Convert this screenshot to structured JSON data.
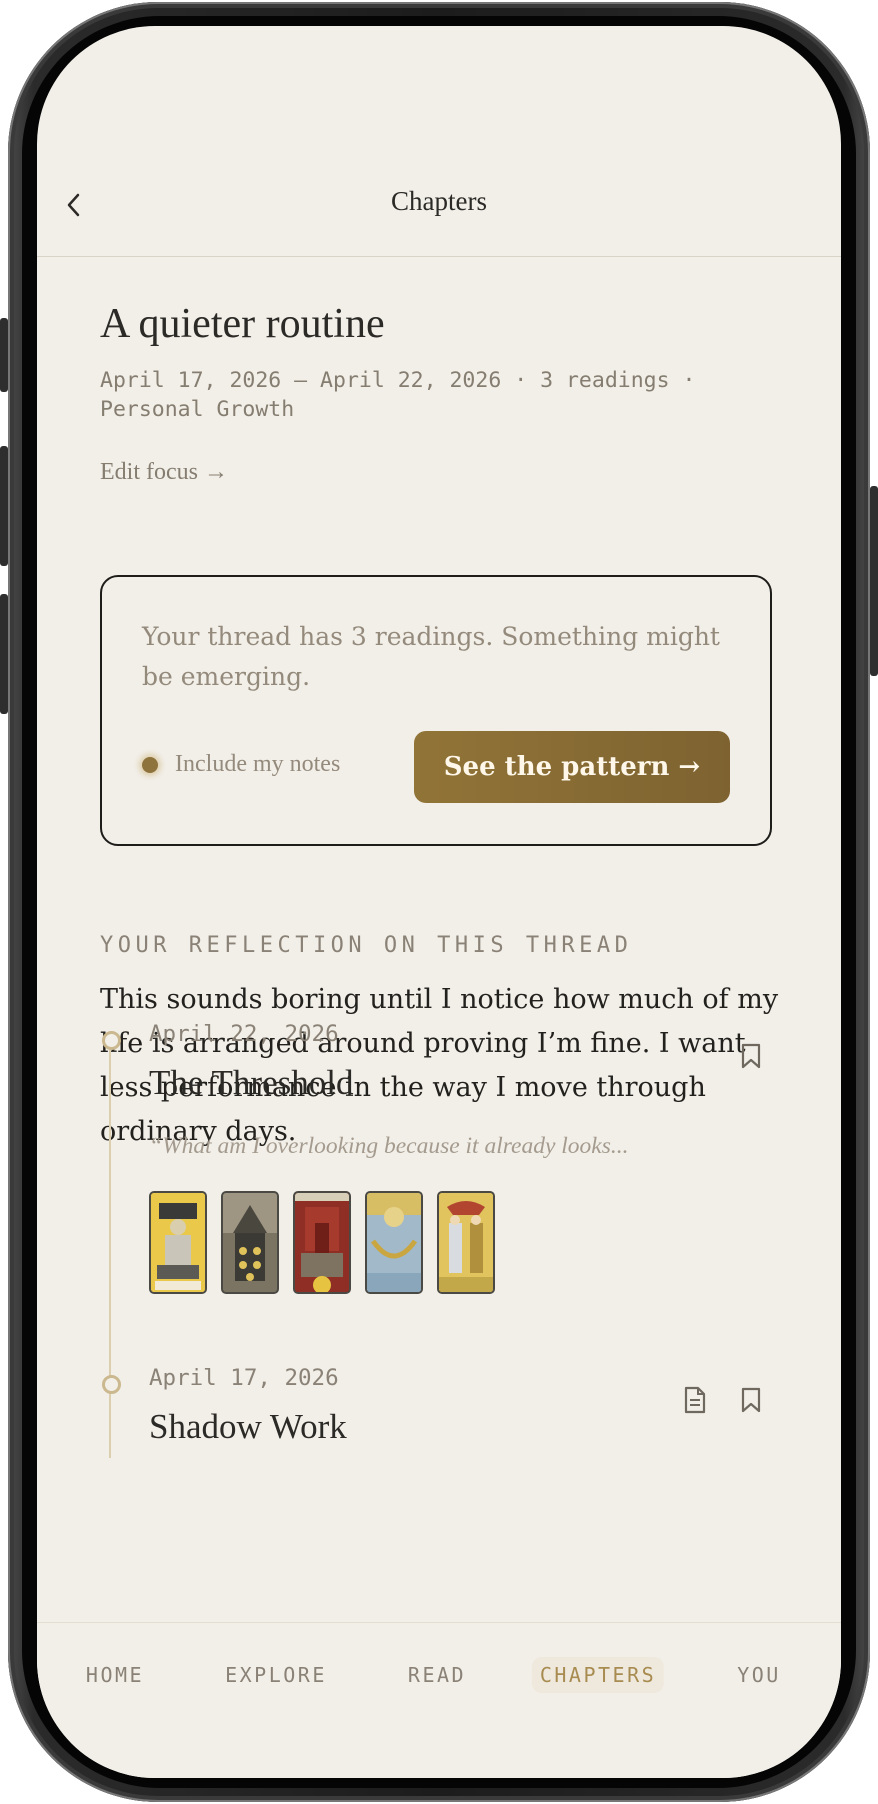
{
  "header": {
    "title": "Chapters"
  },
  "chapter": {
    "title": "A quieter routine",
    "meta": "April 17, 2026 — April 22, 2026 · 3 readings · Personal Growth",
    "edit_focus": "Edit focus →"
  },
  "pattern_card": {
    "text": "Your thread has 3 readings. Something might be emerging.",
    "notes_label": "Include my notes",
    "button_label": "See the pattern →"
  },
  "reflection": {
    "label": "YOUR REFLECTION ON THIS THREAD",
    "text": "This sounds boring until I notice how much of my life is arranged around proving I’m fine. I want less performance in the way I move through ordinary days."
  },
  "entries": [
    {
      "date": "April 22, 2026",
      "title": "The Threshold",
      "quote": "“What am I overlooking because it already looks...",
      "icons": [
        "bookmark-icon"
      ],
      "cards": [
        "The Chariot",
        "Nine of Pentacles",
        "Justice",
        "The Moon",
        "Temperance"
      ]
    },
    {
      "date": "April 17, 2026",
      "title": "Shadow Work",
      "icons": [
        "notes-icon",
        "bookmark-icon"
      ]
    }
  ],
  "nav": {
    "items": [
      "HOME",
      "EXPLORE",
      "READ",
      "CHAPTERS",
      "YOU"
    ],
    "active": "CHAPTERS"
  },
  "colors": {
    "background": "#f2efe9",
    "accent": "#8f733c",
    "text": "#2c2a26",
    "muted": "#857d70"
  }
}
